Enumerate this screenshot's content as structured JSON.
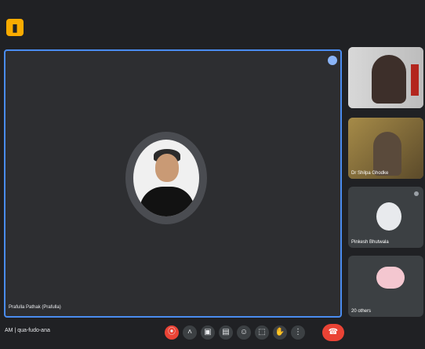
{
  "header": {
    "app_icon": "meet-logo-icon"
  },
  "stage": {
    "presenter_name": "Prafulla Pathak (Prafulla)",
    "pin_icon": "pin-icon"
  },
  "side_tiles": [
    {
      "label": ""
    },
    {
      "label": "Dr Shilpa Ghodke"
    },
    {
      "label": "Pinkesh Bhutwala"
    },
    {
      "label": "20 others"
    }
  ],
  "bottom_bar": {
    "time": "AM",
    "meeting_code": "qua-fudo-ana",
    "controls": [
      {
        "icon": "mic-off-icon",
        "state": "red"
      },
      {
        "icon": "chevron-up-icon"
      },
      {
        "icon": "camera-icon"
      },
      {
        "icon": "captions-icon"
      },
      {
        "icon": "emoji-icon"
      },
      {
        "icon": "present-icon"
      },
      {
        "icon": "raise-hand-icon"
      },
      {
        "icon": "more-icon"
      },
      {
        "icon": "hangup-icon",
        "state": "red"
      }
    ]
  }
}
